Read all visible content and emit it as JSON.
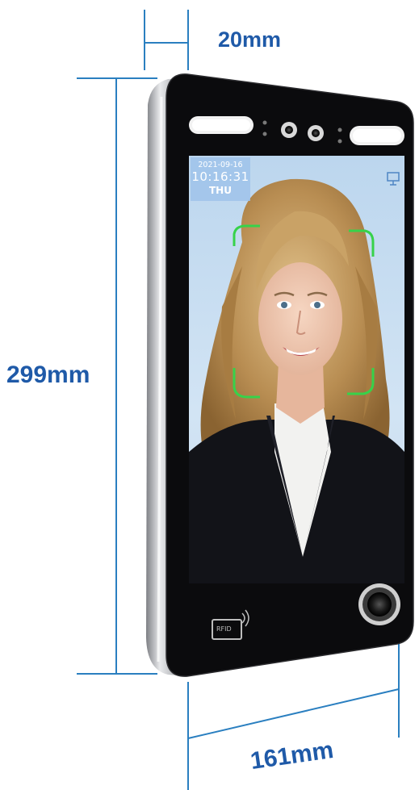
{
  "dimensions": {
    "depth": "20mm",
    "height": "299mm",
    "width": "161mm"
  },
  "screen": {
    "date": "2021-09-16",
    "time": "10:16:31",
    "weekday": "THU"
  },
  "rfid_label": "RFID",
  "colors": {
    "dimension_line": "#2a7fc0",
    "dimension_text": "#1f5aa8",
    "bezel": "#0b0b0d",
    "face_frame": "#37d24a"
  },
  "icons": [
    "monitor-icon",
    "rfid-icon",
    "fingerprint-sensor-icon",
    "camera-lens-icon"
  ]
}
